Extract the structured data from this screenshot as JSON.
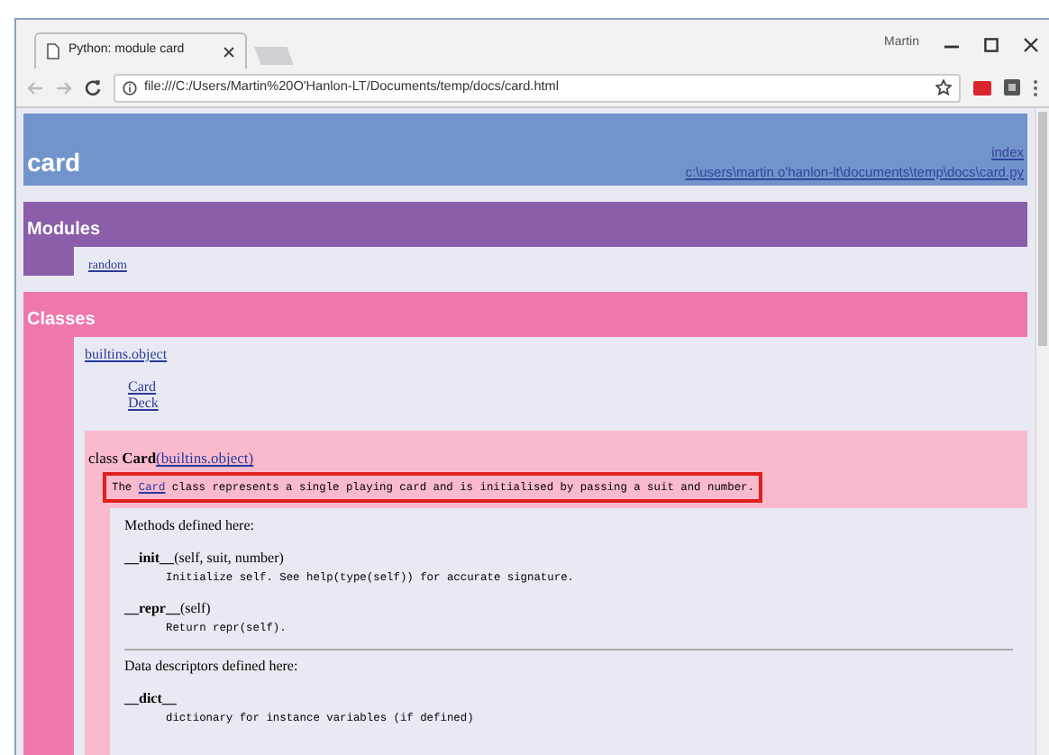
{
  "browser": {
    "tabs": [
      {
        "title": "Python: module card",
        "selected": true
      }
    ],
    "user": "Martin",
    "url": "file:///C:/Users/Martin%20O'Hanlon-LT/Documents/temp/docs/card.html"
  },
  "page": {
    "title": "card",
    "links": [
      "index",
      "c:\\users\\martin o'hanlon-lt\\documents\\temp\\docs\\card.py"
    ],
    "modules": {
      "heading": "Modules",
      "items": [
        "random"
      ]
    },
    "classes": {
      "heading": "Classes",
      "base": "builtins.object",
      "subclasses": [
        "Card",
        "Deck"
      ],
      "class": {
        "keyword": "class",
        "name": "Card",
        "base": "(builtins.object)",
        "doc_before": "The ",
        "doc_link": "Card",
        "doc_after": " class represents a single playing card and is initialised by passing a suit and number.",
        "highlighted": true,
        "methods_heading": "Methods defined here:",
        "methods": [
          {
            "name": "__init__",
            "signature": "(self, suit, number)",
            "doc": "Initialize self.  See help(type(self)) for accurate signature."
          },
          {
            "name": "__repr__",
            "signature": "(self)",
            "doc": "Return repr(self)."
          }
        ],
        "descriptors_heading": "Data descriptors defined here:",
        "descriptors": [
          {
            "name": "__dict__",
            "doc": "dictionary for instance variables (if defined)"
          }
        ]
      }
    }
  }
}
